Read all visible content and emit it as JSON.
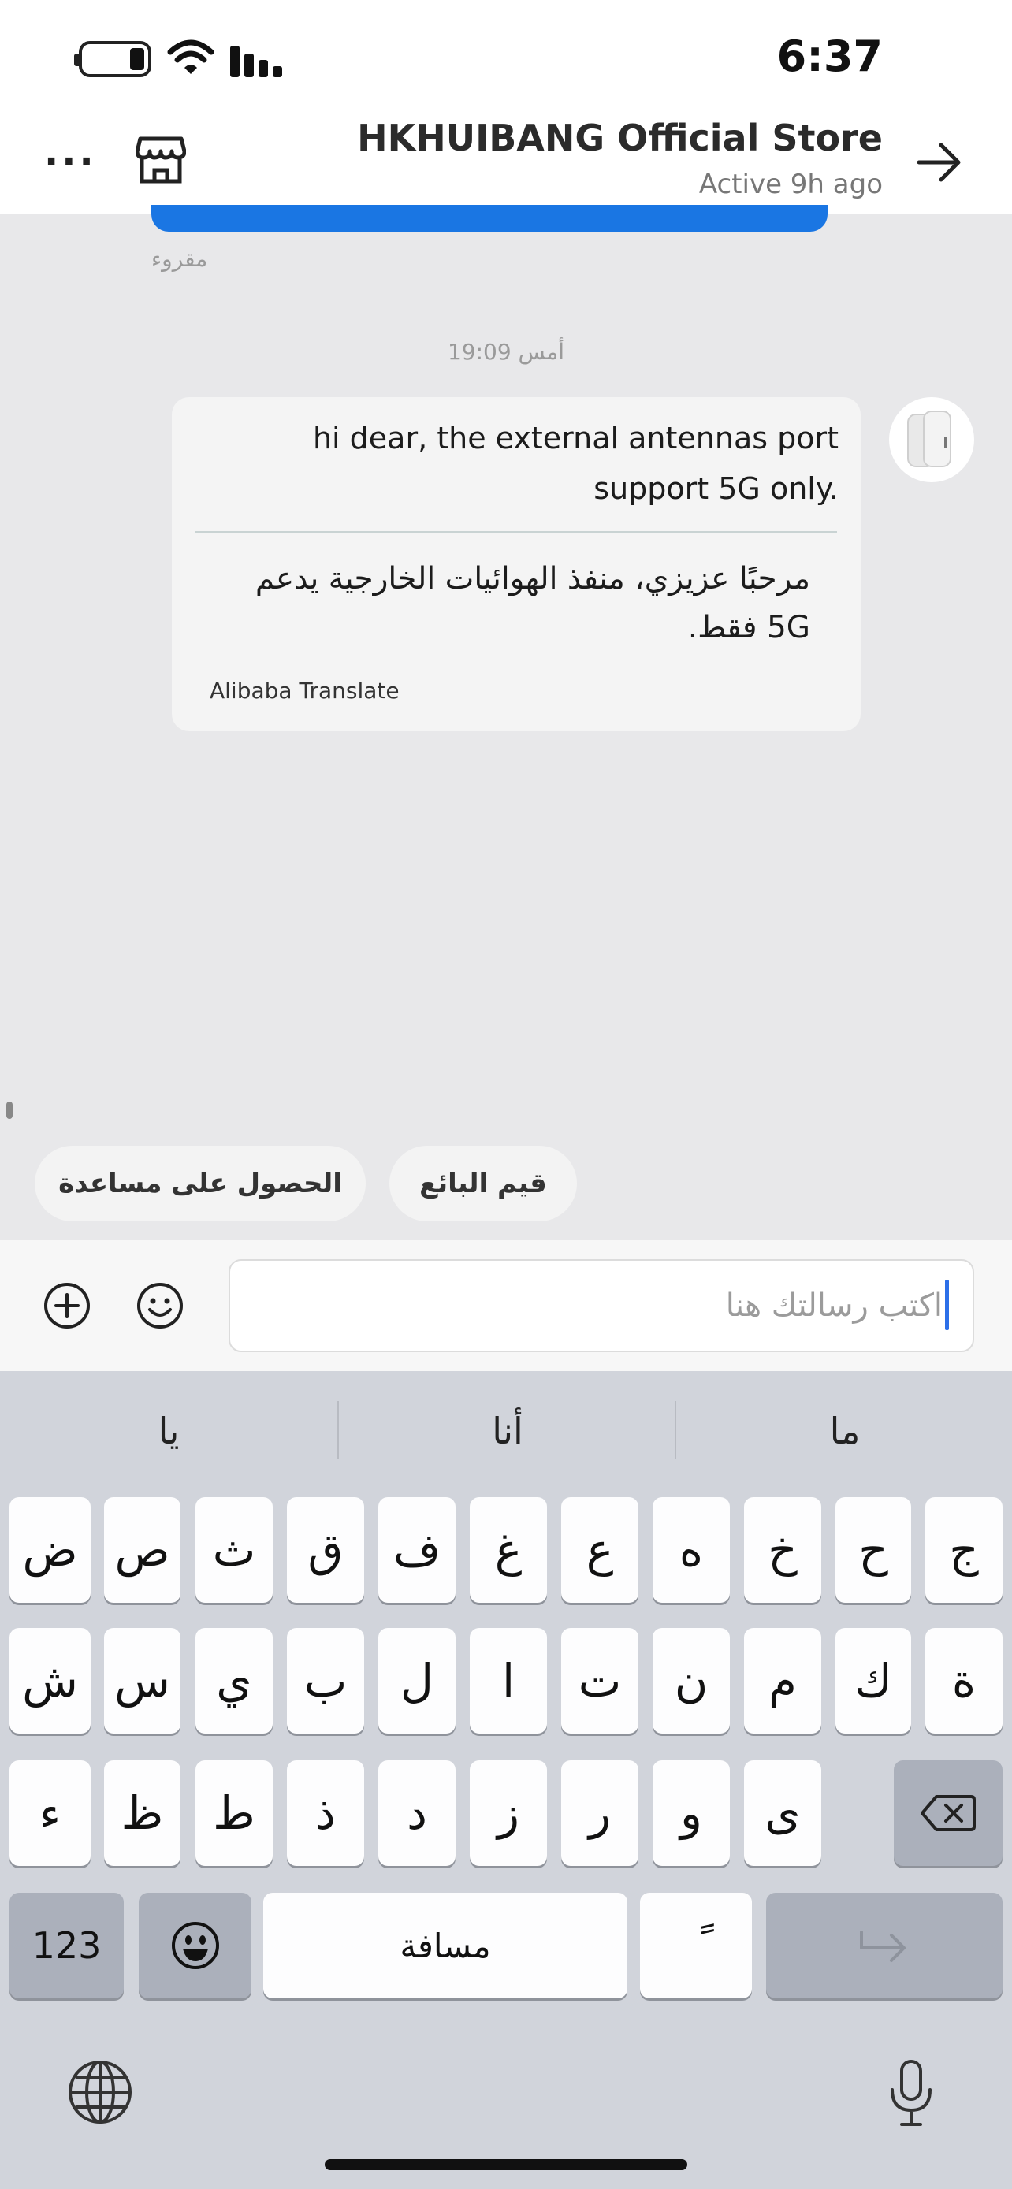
{
  "status_bar": {
    "time": "6:37"
  },
  "header": {
    "title": "HKHUIBANG Official Store",
    "status": "Active 9h ago"
  },
  "chat": {
    "read_label": "مقروء",
    "time_separator": "أمس 19:09",
    "message": {
      "original": "hi dear, the external antennas port support 5G only.",
      "translated": "مرحبًا عزيزي، منفذ الهوائيات الخارجية يدعم 5G فقط.",
      "translator": "Alibaba Translate"
    }
  },
  "quick_replies": [
    {
      "label": "قيم البائع"
    },
    {
      "label": "الحصول على مساعدة"
    }
  ],
  "composer": {
    "placeholder": "اكتب رسالتك هنا"
  },
  "keyboard": {
    "suggestions": [
      "يا",
      "أنا",
      "ما"
    ],
    "row1": [
      "ض",
      "ص",
      "ث",
      "ق",
      "ف",
      "غ",
      "ع",
      "ه",
      "خ",
      "ح",
      "ج"
    ],
    "row2": [
      "ش",
      "س",
      "ي",
      "ب",
      "ل",
      "ا",
      "ت",
      "ن",
      "م",
      "ك",
      "ة"
    ],
    "row3": [
      "ء",
      "ظ",
      "ط",
      "ذ",
      "د",
      "ز",
      "ر",
      "و",
      "ى"
    ],
    "numbers_key": "123",
    "space_key": "مسافة",
    "diacritic_key": "ً"
  },
  "colors": {
    "accent_blue": "#1a76e3",
    "keyboard_bg": "#d1d4db",
    "chat_bg": "#e8e8ea"
  }
}
